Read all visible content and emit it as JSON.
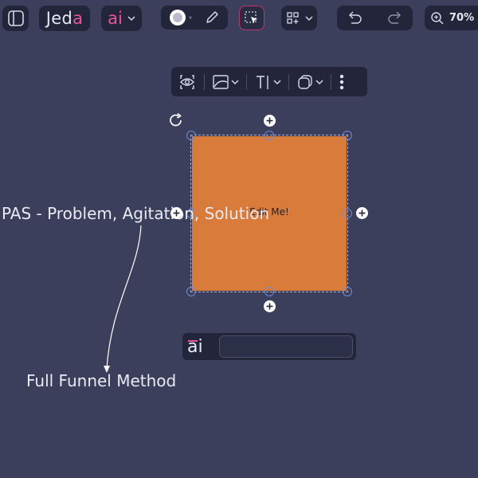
{
  "toolbar": {
    "brand": {
      "prefix": "Jed",
      "accent": "a"
    },
    "ai_label": "ai",
    "zoom": "70%"
  },
  "canvas": {
    "text_pas": "PAS - Problem, Agitation, Solution",
    "text_funnel": "Full Funnel Method",
    "shape": {
      "label": "Edit Me!",
      "fill": "#d97b3b"
    }
  },
  "ai_prompt": {
    "label": "ai",
    "value": "",
    "placeholder": ""
  },
  "colors": {
    "background": "#3c3f5c",
    "panel": "#23263a",
    "accent": "#e8559a",
    "handle": "#6e8bd8"
  }
}
